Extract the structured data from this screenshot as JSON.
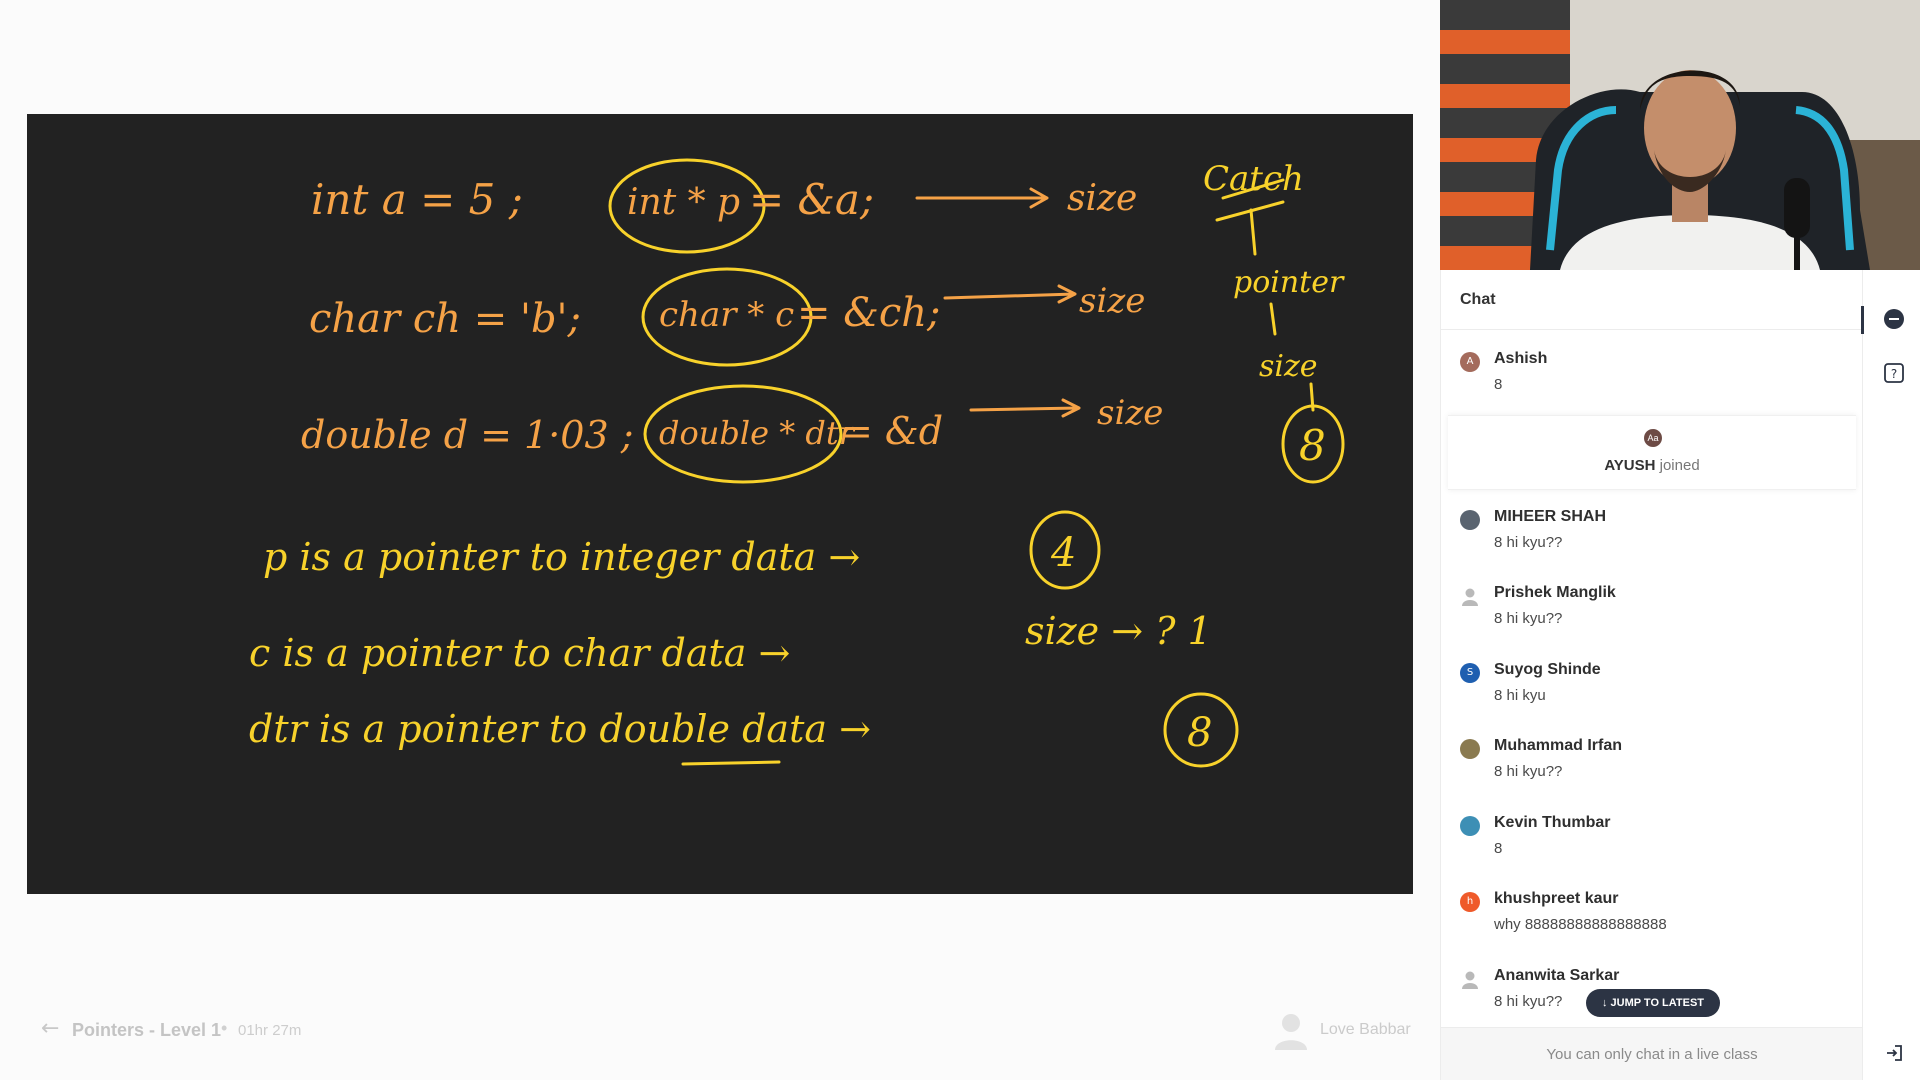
{
  "board": {
    "row1": {
      "decl": "int a = 5 ;",
      "ptr": "int * p",
      "rhs": "= &a;",
      "tail": "size"
    },
    "row2": {
      "decl": "char ch = 'b';",
      "ptr": "char * c",
      "rhs": "= &ch;",
      "tail": "size"
    },
    "row3": {
      "decl": "double d = 1·03 ;",
      "ptr": "double * dtr",
      "rhs": "= &d",
      "tail": "size"
    },
    "side": {
      "catch": "Catch",
      "pointer": "pointer",
      "size": "size",
      "eight": "8"
    },
    "line1": {
      "text": "p is a pointer to integer data →",
      "circled": "4"
    },
    "line2": {
      "text": "c is a pointer to char data →",
      "size_note": "size → ? 1"
    },
    "line3": {
      "text": "dtr is a pointer to double data →",
      "circled": "8"
    }
  },
  "bottom_bar": {
    "back_icon": "arrow-left-icon",
    "lecture_title": "Pointers - Level 1",
    "separator": "•",
    "duration": "01hr 27m",
    "instructor": "Love Babbar"
  },
  "chat": {
    "title": "Chat",
    "messages": [
      {
        "initial": "A",
        "name": "Ashish",
        "text": "8",
        "color": "#a46b5c"
      },
      {
        "initial": "",
        "name": "MIHEER SHAH",
        "text": "8 hi kyu??",
        "color": "#5a6470"
      },
      {
        "initial": "",
        "name": "Prishek Manglik",
        "text": "8 hi kyu??",
        "color": "#b9b9b9"
      },
      {
        "initial": "S",
        "name": "Suyog Shinde",
        "text": "8 hi kyu",
        "color": "#1f5fb0"
      },
      {
        "initial": "",
        "name": "Muhammad Irfan",
        "text": "8 hi kyu??",
        "color": "#8a7a50"
      },
      {
        "initial": "",
        "name": "Kevin Thumbar",
        "text": "8",
        "color": "#3d8fb5"
      },
      {
        "initial": "h",
        "name": "khushpreet kaur",
        "text": "why 88888888888888888",
        "color": "#ef5a2a"
      },
      {
        "initial": "",
        "name": "Ananwita Sarkar",
        "text": "8 hi kyu??",
        "color": "#b9b9b9"
      }
    ],
    "joined": {
      "avatar": "Aa",
      "name": "AYUSH",
      "suffix": " joined"
    },
    "jump_button": "↓ JUMP TO LATEST",
    "footer": "You can only chat in a live class"
  },
  "rail": {
    "icons": [
      "chat-bubble-icon",
      "question-icon",
      "exit-icon"
    ]
  }
}
